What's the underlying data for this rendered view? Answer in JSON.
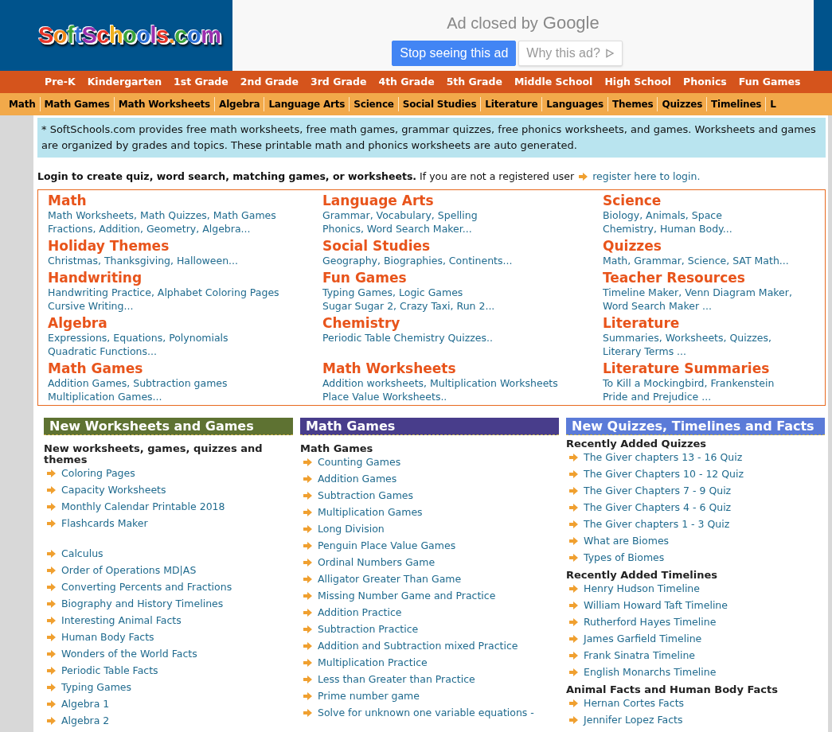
{
  "header": {
    "logo": "SoftSchools.com",
    "ad": {
      "message": "Ad closed by",
      "brand": "Google",
      "buttons": [
        {
          "label": "Stop seeing this ad",
          "kind": "primary"
        },
        {
          "label": "Why this ad?",
          "kind": "secondary"
        }
      ]
    }
  },
  "grade_nav": [
    "Pre-K",
    "Kindergarten",
    "1st Grade",
    "2nd Grade",
    "3rd Grade",
    "4th Grade",
    "5th Grade",
    "Middle School",
    "High School",
    "Phonics",
    "Fun Games"
  ],
  "subject_nav": [
    "Math",
    "Math Games",
    "Math Worksheets",
    "Algebra",
    "Language Arts",
    "Science",
    "Social Studies",
    "Literature",
    "Languages",
    "Themes",
    "Quizzes",
    "Timelines",
    "L"
  ],
  "intro": "* SoftSchools.com provides free math worksheets, free math games, grammar quizzes, free phonics worksheets, and games. Worksheets and games are organized by grades and topics. These printable math and phonics worksheets are auto generated.",
  "login": {
    "text": "**Login to create quiz, word search, matching games, or worksheets.** If you are not a registered user",
    "link": "register here to login."
  },
  "topics": [
    {
      "title": "Math",
      "lines": [
        "Math Worksheets, Math Quizzes, Math Games",
        "Fractions, Addition, Geometry, Algebra..."
      ]
    },
    {
      "title": "Language Arts",
      "lines": [
        "Grammar, Vocabulary, Spelling",
        "Phonics, Word Search Maker..."
      ]
    },
    {
      "title": "Science",
      "lines": [
        "Biology, Animals, Space",
        "Chemistry, Human Body..."
      ]
    },
    {
      "title": "Holiday Themes",
      "lines": [
        "Christmas, Thanksgiving, Halloween..."
      ]
    },
    {
      "title": "Social Studies",
      "lines": [
        "Geography, Biographies, Continents..."
      ]
    },
    {
      "title": "Quizzes",
      "lines": [
        "Math, Grammar, Science, SAT Math..."
      ]
    },
    {
      "title": "Handwriting",
      "lines": [
        "Handwriting Practice, Alphabet Coloring Pages",
        "Cursive Writing..."
      ]
    },
    {
      "title": "Fun Games",
      "lines": [
        "Typing Games, Logic Games",
        "Sugar Sugar 2, Crazy Taxi, Run 2..."
      ]
    },
    {
      "title": "Teacher Resources",
      "lines": [
        "Timeline Maker, Venn Diagram Maker,",
        "Word Search Maker ..."
      ]
    },
    {
      "title": "Algebra",
      "lines": [
        "Expressions, Equations, Polynomials",
        "Quadratic Functions..."
      ]
    },
    {
      "title": "Chemistry",
      "lines": [
        "Periodic Table Chemistry Quizzes.."
      ]
    },
    {
      "title": "Literature",
      "lines": [
        "Summaries, Worksheets, Quizzes,",
        "Literary Terms ..."
      ]
    },
    {
      "title": "Math Games",
      "lines": [
        "Addition Games, Subtraction games",
        "Multiplication Games..."
      ]
    },
    {
      "title": "Math Worksheets",
      "lines": [
        "Addition worksheets, Multiplication Worksheets",
        "Place Value Worksheets.."
      ]
    },
    {
      "title": "Literature Summaries",
      "lines": [
        "To Kill a Mockingbird, Frankenstein",
        "Pride and Prejudice ..."
      ]
    }
  ],
  "sections": [
    {
      "title": "New Worksheets and Games",
      "color": "#5e7232",
      "groups": [
        {
          "heading": "New worksheets, games, quizzes and themes",
          "items": [
            "Coloring Pages",
            "Capacity Worksheets",
            "Monthly Calendar Printable 2018",
            "Flashcards Maker"
          ]
        },
        {
          "items": [
            "Calculus",
            "Order of Operations MD|AS",
            "Converting Percents and Fractions",
            "Biography and History Timelines",
            "Interesting Animal Facts",
            "Human Body Facts",
            "Wonders of the World Facts",
            "Periodic Table Facts",
            "Typing Games",
            "Algebra 1",
            "Algebra 2"
          ]
        }
      ]
    },
    {
      "title": "Math Games",
      "color": "#483d8b",
      "groups": [
        {
          "heading": "Math Games",
          "items": [
            "Counting Games",
            "Addition Games",
            "Subtraction Games",
            "Multiplication Games",
            "Long Division",
            "Penguin Place Value Games",
            "Ordinal Numbers Game",
            "Alligator Greater Than Game",
            "Missing Number Game and Practice",
            "Addition Practice",
            "Subtraction Practice",
            "Addition and Subtraction mixed Practice",
            "Multiplication Practice",
            "Less than Greater than Practice",
            "Prime number game",
            "Solve for unknown one variable equations -"
          ]
        }
      ]
    },
    {
      "title": "New Quizzes, Timelines and Facts",
      "color": "#5b7bd8",
      "groups": [
        {
          "heading": "Recently Added Quizzes",
          "items": [
            "The Giver chapters 13 - 16 Quiz",
            "The Giver Chapters 10 - 12 Quiz",
            "The Giver Chapters 7 - 9 Quiz",
            "The Giver Chapters 4 - 6 Quiz",
            "The Giver chapters 1 - 3 Quiz",
            "What are Biomes",
            "Types of Biomes"
          ]
        },
        {
          "heading": "Recently Added Timelines",
          "items": [
            "Henry Hudson Timeline",
            "William Howard Taft Timeline",
            "Rutherford Hayes Timeline",
            "James Garfield Timeline",
            "Frank Sinatra Timeline",
            "English Monarchs Timeline"
          ]
        },
        {
          "heading": "Animal Facts and Human Body Facts",
          "items": [
            "Hernan Cortes Facts",
            "Jennifer Lopez Facts"
          ]
        }
      ]
    }
  ]
}
